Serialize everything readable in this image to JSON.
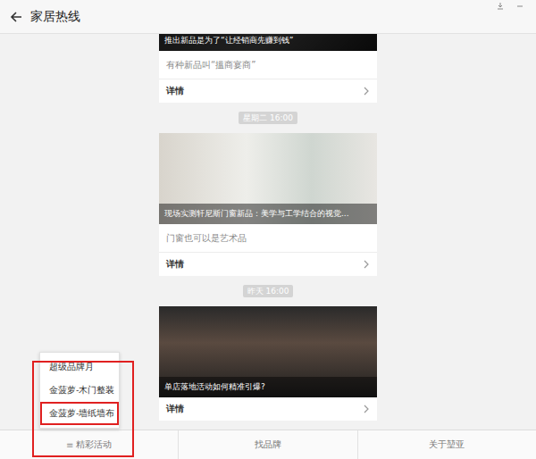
{
  "window": {
    "title": "家居热线"
  },
  "feed": [
    {
      "kind": "card",
      "title": "推出新品是为了“让经销商先赚到钱”",
      "digest": "有种新品叫“搵商宴商”",
      "more": "详情"
    },
    {
      "kind": "time",
      "text": "星期二 16:00"
    },
    {
      "kind": "card",
      "title": "现场实测轩尼斯门窗新品：美学与工学结合的视觉...",
      "digest": "门窗也可以是艺术品",
      "more": "详情"
    },
    {
      "kind": "time",
      "text": "昨天 16:00"
    },
    {
      "kind": "card",
      "title": "单店落地活动如何精准引爆?",
      "more": "详情"
    }
  ],
  "menu": {
    "open": true,
    "items": [
      {
        "label": "超级品牌月",
        "highlighted": false
      },
      {
        "label": "金菠萝-木门整装",
        "highlighted": false
      },
      {
        "label": "金菠萝-墙纸墙布",
        "highlighted": true
      }
    ]
  },
  "tabs": [
    {
      "label": "精彩活动",
      "icon": "≡"
    },
    {
      "label": "找品牌"
    },
    {
      "label": "关于堃亚"
    }
  ]
}
